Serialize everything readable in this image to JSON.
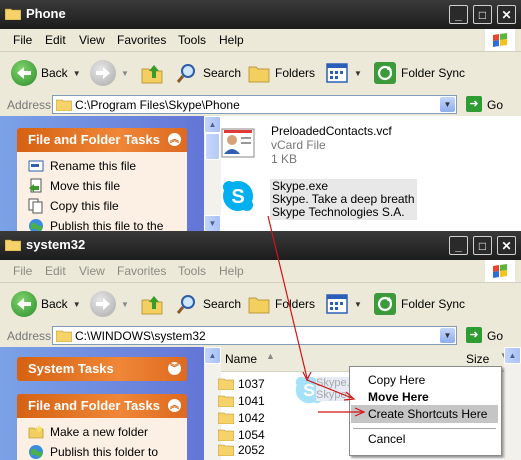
{
  "top_window": {
    "title": "Phone",
    "menu": [
      "File",
      "Edit",
      "View",
      "Favorites",
      "Tools",
      "Help"
    ],
    "toolbar": {
      "back": "Back",
      "search": "Search",
      "folders": "Folders",
      "folder_sync": "Folder Sync"
    },
    "address_label": "Address",
    "address_path": "C:\\Program Files\\Skype\\Phone",
    "go": "Go",
    "task_panel_title": "File and Folder Tasks",
    "tasks": [
      "Rename this file",
      "Move this file",
      "Copy this file",
      "Publish this file to the"
    ],
    "files": [
      {
        "name": "PreloadedContacts.vcf",
        "type": "vCard File",
        "size": "1 KB"
      },
      {
        "name": "Skype.exe",
        "desc": "Skype. Take a deep breath",
        "company": "Skype Technologies S.A."
      }
    ]
  },
  "bottom_window": {
    "title": "system32",
    "menu": [
      "File",
      "Edit",
      "View",
      "Favorites",
      "Tools",
      "Help"
    ],
    "toolbar": {
      "back": "Back",
      "search": "Search",
      "folders": "Folders",
      "folder_sync": "Folder Sync"
    },
    "address_label": "Address",
    "address_path": "C:\\WINDOWS\\system32",
    "go": "Go",
    "system_tasks_title": "System Tasks",
    "file_tasks_title": "File and Folder Tasks",
    "tasks": [
      "Make a new folder",
      "Publish this folder to"
    ],
    "columns": {
      "name": "Name",
      "size": "Size"
    },
    "folders": [
      "1037",
      "1041",
      "1042",
      "1054",
      "2052"
    ],
    "drag_ghost": {
      "name": "Skype.exe",
      "desc": "Skype. T"
    }
  },
  "context_menu": {
    "items": [
      "Copy Here",
      "Move Here",
      "Create Shortcuts Here",
      "Cancel"
    ],
    "default_item": "Move Here",
    "selected_item": "Create Shortcuts Here"
  },
  "colors": {
    "accent_orange": "#e9761c",
    "task_blue": "#6f8fe0",
    "drag_arrow": "#d41313"
  }
}
